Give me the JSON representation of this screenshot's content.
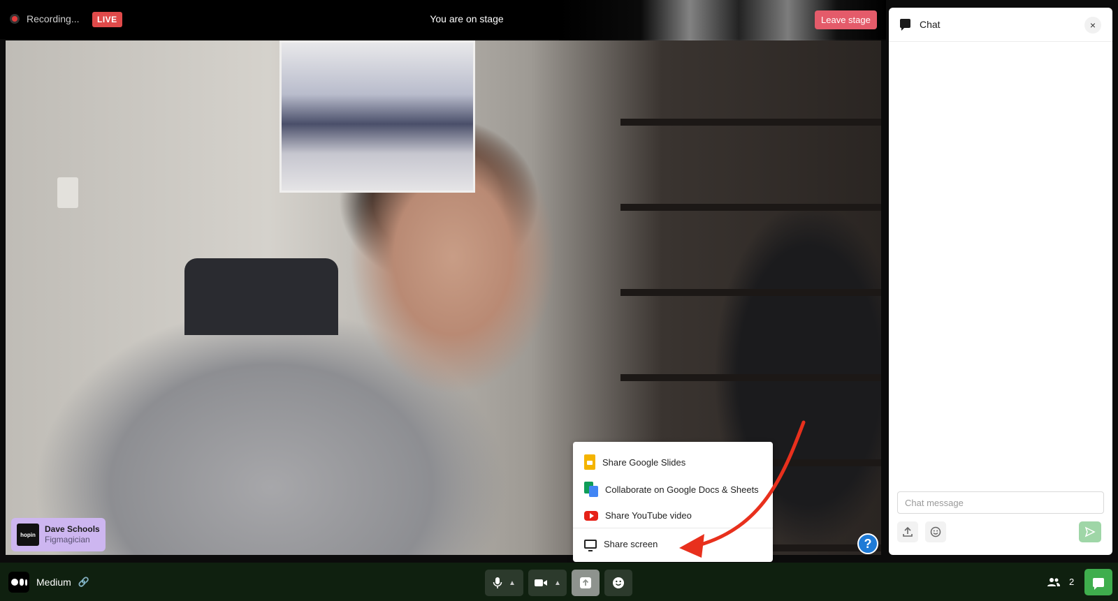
{
  "topbar": {
    "recording_label": "Recording...",
    "live_badge": "LIVE",
    "stage_title": "You are on stage",
    "leave_button": "Leave stage"
  },
  "speaker": {
    "logo_text": "hopin",
    "name": "Dave Schools",
    "role": "Figmagician"
  },
  "share_menu": {
    "items": [
      {
        "label": "Share Google Slides",
        "icon": "google-slides-icon"
      },
      {
        "label": "Collaborate on Google Docs & Sheets",
        "icon": "google-docs-sheets-icon"
      },
      {
        "label": "Share YouTube video",
        "icon": "youtube-icon"
      },
      {
        "label": "Share screen",
        "icon": "monitor-icon"
      }
    ]
  },
  "help": {
    "label": "?"
  },
  "chat": {
    "title": "Chat",
    "close": "×",
    "input_placeholder": "Chat message",
    "input_value": ""
  },
  "bottombar": {
    "room_name": "Medium",
    "link_icon": "🔗",
    "people_count": "2"
  },
  "colors": {
    "live": "#e04a4a",
    "leave_stage": "#e45b6a",
    "namecard": "#cdb6f0",
    "bottombar": "#0f200f",
    "chat_toggle": "#3fae4d",
    "arrow": "#e8301d"
  }
}
